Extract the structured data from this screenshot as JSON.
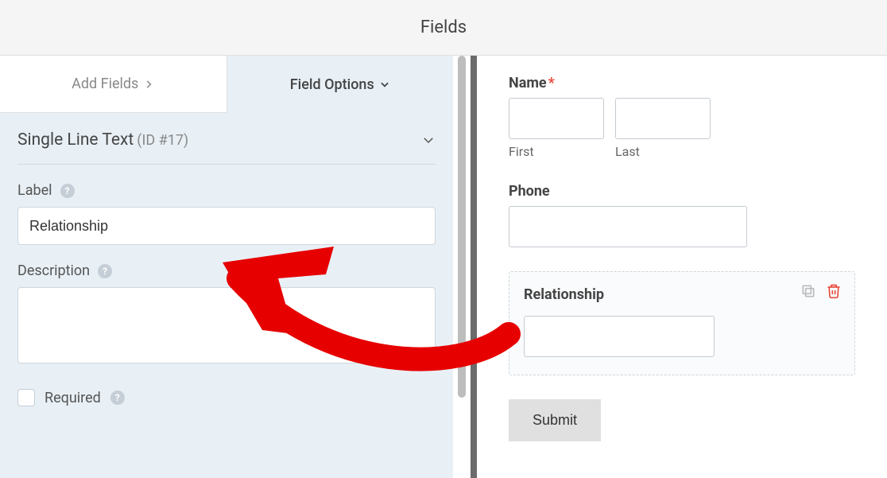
{
  "header": {
    "title": "Fields"
  },
  "tabs": {
    "add_fields": "Add Fields",
    "field_options": "Field Options"
  },
  "field_identity": {
    "type_label": "Single Line Text",
    "id_label": "(ID #17)"
  },
  "options": {
    "label_heading": "Label",
    "label_value": "Relationship",
    "description_heading": "Description",
    "description_value": "",
    "required_label": "Required"
  },
  "preview": {
    "name": {
      "label": "Name",
      "required": true,
      "first_sub": "First",
      "last_sub": "Last"
    },
    "phone": {
      "label": "Phone"
    },
    "relationship": {
      "label": "Relationship"
    },
    "submit_label": "Submit"
  }
}
